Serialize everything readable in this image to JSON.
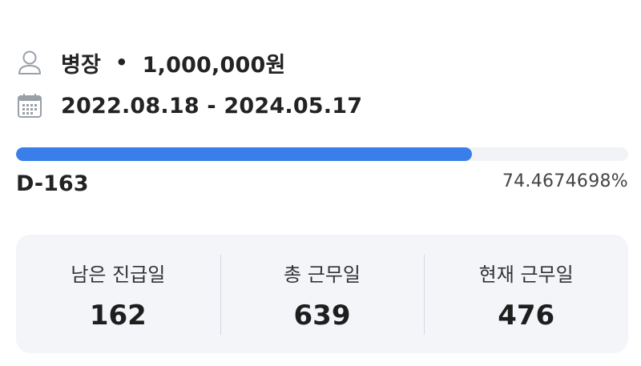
{
  "service": {
    "rank": "병장",
    "separator": "•",
    "salary": "1,000,000원",
    "period": "2022.08.18 - 2024.05.17"
  },
  "progress": {
    "fraction": 0.744674698,
    "dday": "D-163",
    "percent_text": "74.4674698%",
    "color": "#3a7eea",
    "track_color": "#f1f3f7"
  },
  "stats": [
    {
      "label": "남은 진급일",
      "value": "162"
    },
    {
      "label": "총 근무일",
      "value": "639"
    },
    {
      "label": "현재 근무일",
      "value": "476"
    }
  ],
  "icons": {
    "rank": "user-icon",
    "period": "calendar-icon"
  }
}
